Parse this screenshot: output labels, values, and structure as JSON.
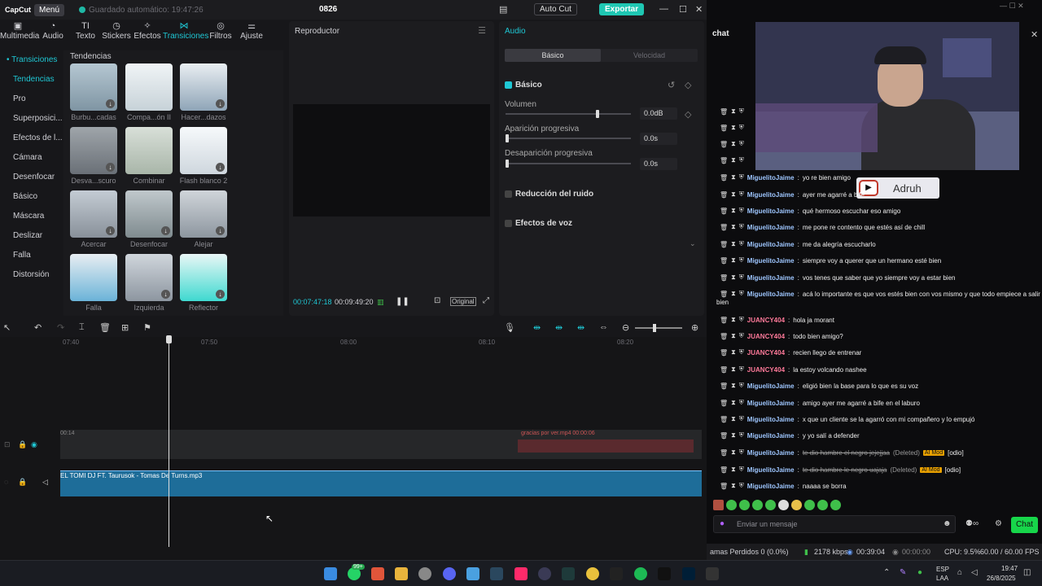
{
  "capcut": {
    "logo": "CapCut",
    "menu": "Menú",
    "autosave": "Guardado automático: 19:47:26",
    "project": "0826",
    "autocut": "Auto Cut",
    "export": "Exportar",
    "tools": [
      {
        "label": "Multimedia",
        "icon": "media-icon"
      },
      {
        "label": "Audio",
        "icon": "audio-icon"
      },
      {
        "label": "Texto",
        "icon": "text-icon"
      },
      {
        "label": "Stickers",
        "icon": "sticker-icon"
      },
      {
        "label": "Efectos",
        "icon": "effects-icon"
      },
      {
        "label": "Transiciones",
        "icon": "transition-icon"
      },
      {
        "label": "Filtros",
        "icon": "filter-icon"
      },
      {
        "label": "Ajuste",
        "icon": "adjust-icon"
      }
    ],
    "sidebar": [
      "• Transiciones",
      "Tendencias",
      "Pro",
      "Superposici...",
      "Efectos de l...",
      "Cámara",
      "Desenfocar",
      "Básico",
      "Máscara",
      "Deslizar",
      "Falla",
      "Distorsión"
    ],
    "library_title": "Tendencias",
    "transitions": [
      "Burbu...cadas",
      "Compa...ón II",
      "Hacer...dazos",
      "Desva...scuro",
      "Combinar",
      "Flash blanco 2",
      "Acercar",
      "Desenfocar",
      "Alejar",
      "Falla",
      "Izquierda",
      "Reflector"
    ],
    "player": {
      "title": "Reproductor",
      "current": "00:07:47:18",
      "total": "00:09:49:20",
      "original": "Original"
    },
    "audio_panel": {
      "title": "Audio",
      "tab_basic": "Básico",
      "tab_speed": "Velocidad",
      "section_basic": "Básico",
      "volume_label": "Volumen",
      "volume_value": "0.0dB",
      "fadein_label": "Aparición progresiva",
      "fadein_value": "0.0s",
      "fadeout_label": "Desaparición progresiva",
      "fadeout_value": "0.0s",
      "noise": "Reducción del ruido",
      "voice": "Efectos de voz"
    },
    "timeline": {
      "ticks": [
        "07:40",
        "07:50",
        "08:00",
        "08:10",
        "08:20"
      ],
      "audio_clip": "EL TOMI DJ FT. Taurusok - Tomas De Turns.mp3",
      "video_clip_left": "00:14",
      "video_clip_right": "gracias por ver.mp4  00:00:06"
    }
  },
  "stream": {
    "chat_title": "chat",
    "overlay_name": "Adruh",
    "messages": [
      {
        "user": "MiguelitoJaime",
        "text": "yo re bien amigo",
        "color": "#9ec6ff"
      },
      {
        "user": "MiguelitoJaime",
        "text": "ayer me agarré a bife",
        "color": "#9ec6ff"
      },
      {
        "user": "MiguelitoJaime",
        "text": "qué hermoso escuchar eso amigo",
        "color": "#9ec6ff"
      },
      {
        "user": "MiguelitoJaime",
        "text": "me pone re contento que estés así de chill",
        "color": "#9ec6ff"
      },
      {
        "user": "MiguelitoJaime",
        "text": "me da alegría escucharlo",
        "color": "#9ec6ff"
      },
      {
        "user": "MiguelitoJaime",
        "text": "siempre voy a querer que un hermano esté bien",
        "color": "#9ec6ff"
      },
      {
        "user": "MiguelitoJaime",
        "text": "vos tenes que saber que yo siempre voy a estar bien",
        "color": "#9ec6ff"
      },
      {
        "user": "MiguelitoJaime",
        "text": "acá lo importante es que vos estés bien con vos mismo y que todo empiece a salir",
        "color": "#9ec6ff"
      },
      {
        "user": "JUANCY404",
        "text": "hola ja morant",
        "color": "#ff7a9a"
      },
      {
        "user": "JUANCY404",
        "text": "todo bien amigo?",
        "color": "#ff7a9a"
      },
      {
        "user": "JUANCY404",
        "text": "recien llego de entrenar",
        "color": "#ff7a9a"
      },
      {
        "user": "JUANCY404",
        "text": "la estoy volcando nashee",
        "color": "#ff7a9a"
      },
      {
        "user": "MiguelitoJaime",
        "text": "eligió bien la base para lo que es su voz",
        "color": "#9ec6ff"
      },
      {
        "user": "MiguelitoJaime",
        "text": "amigo ayer me agarré a bife en el laburo",
        "color": "#9ec6ff"
      },
      {
        "user": "MiguelitoJaime",
        "text": "x que un cliente se la agarró con mi compañero y lo empujó",
        "color": "#9ec6ff"
      },
      {
        "user": "MiguelitoJaime",
        "text": "y yo salí a defender",
        "color": "#9ec6ff"
      },
      {
        "user": "MiguelitoJaime",
        "text": "naaaa se borra",
        "color": "#9ec6ff"
      }
    ],
    "wrap_text": "bien",
    "deleted_1": "te dio hambre el negro jejejjaa",
    "deleted_2": "te dio hambre le negro uajaja",
    "deleted_tag": "(Deleted)",
    "mod_tag": "AI Mod",
    "odio_tag": "[odio]",
    "input_placeholder": "Enviar un mensaje",
    "chat_button": "Chat",
    "status": {
      "frames": "amas Perdidos 0 (0.0%)",
      "bitrate": "2178 kbps",
      "stream_time": "00:39:04",
      "rec_time": "00:00:00",
      "cpu": "CPU: 9.5%",
      "fps": "60.00 / 60.00 FPS"
    }
  },
  "taskbar": {
    "badge": "99+",
    "lang": "ESP",
    "region": "LAA",
    "time": "19:47",
    "date": "26/8/2025"
  }
}
